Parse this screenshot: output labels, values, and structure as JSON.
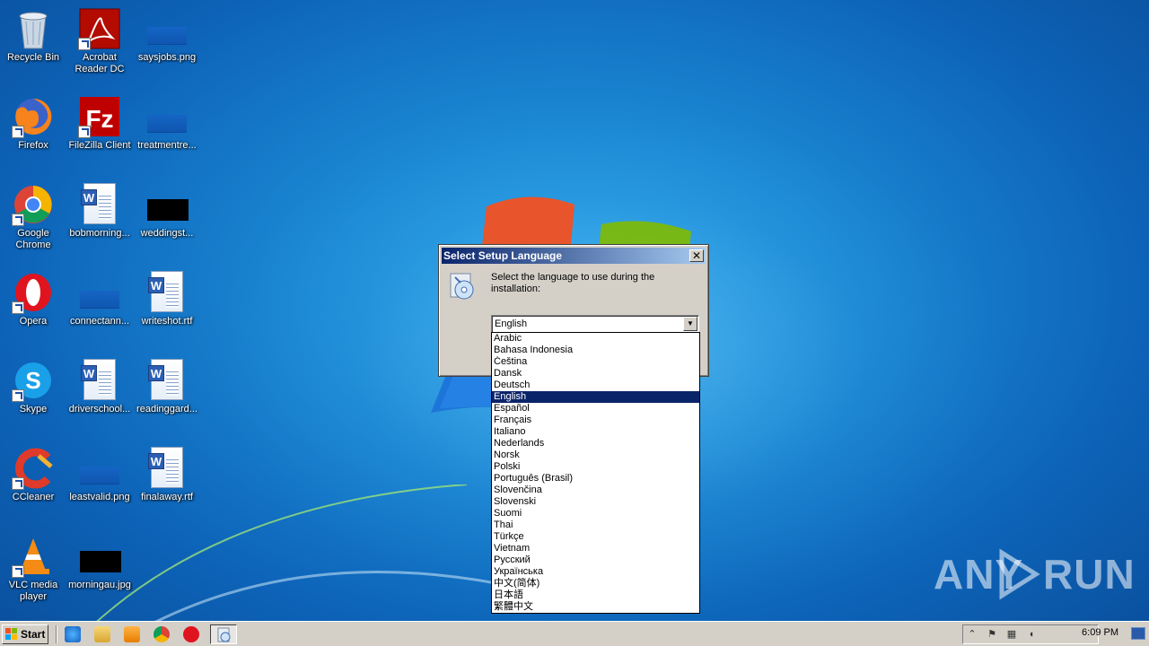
{
  "desktop": {
    "icons": [
      {
        "label": "Recycle Bin"
      },
      {
        "label": "Acrobat Reader DC"
      },
      {
        "label": "saysjobs.png"
      },
      {
        "label": "Firefox"
      },
      {
        "label": "FileZilla Client"
      },
      {
        "label": "treatmentre..."
      },
      {
        "label": "Google Chrome"
      },
      {
        "label": "bobmorning..."
      },
      {
        "label": "weddingst..."
      },
      {
        "label": "Opera"
      },
      {
        "label": "connectann..."
      },
      {
        "label": "writeshot.rtf"
      },
      {
        "label": "Skype"
      },
      {
        "label": "driverschool..."
      },
      {
        "label": "readinggard..."
      },
      {
        "label": "CCleaner"
      },
      {
        "label": "leastvalid.png"
      },
      {
        "label": "finalaway.rtf"
      },
      {
        "label": "VLC media player"
      },
      {
        "label": "morningau.jpg"
      }
    ]
  },
  "dialog": {
    "title": "Select Setup Language",
    "close_glyph": "✕",
    "prompt": "Select the language to use during the installation:",
    "selected_language": "English",
    "dropdown_arrow": "▼"
  },
  "languages": [
    "Arabic",
    "Bahasa Indonesia",
    "Čeština",
    "Dansk",
    "Deutsch",
    "English",
    "Español",
    "Français",
    "Italiano",
    "Nederlands",
    "Norsk",
    "Polski",
    "Português (Brasil)",
    "Slovenčina",
    "Slovenski",
    "Suomi",
    "Thai",
    "Türkçe",
    "Vietnam",
    "Русский",
    "Українська",
    "中文(简体)",
    "日本語",
    "繁體中文"
  ],
  "taskbar": {
    "start_label": "Start",
    "clock": "6:09 PM"
  },
  "watermark": {
    "left": "ANY",
    "right": "RUN"
  }
}
